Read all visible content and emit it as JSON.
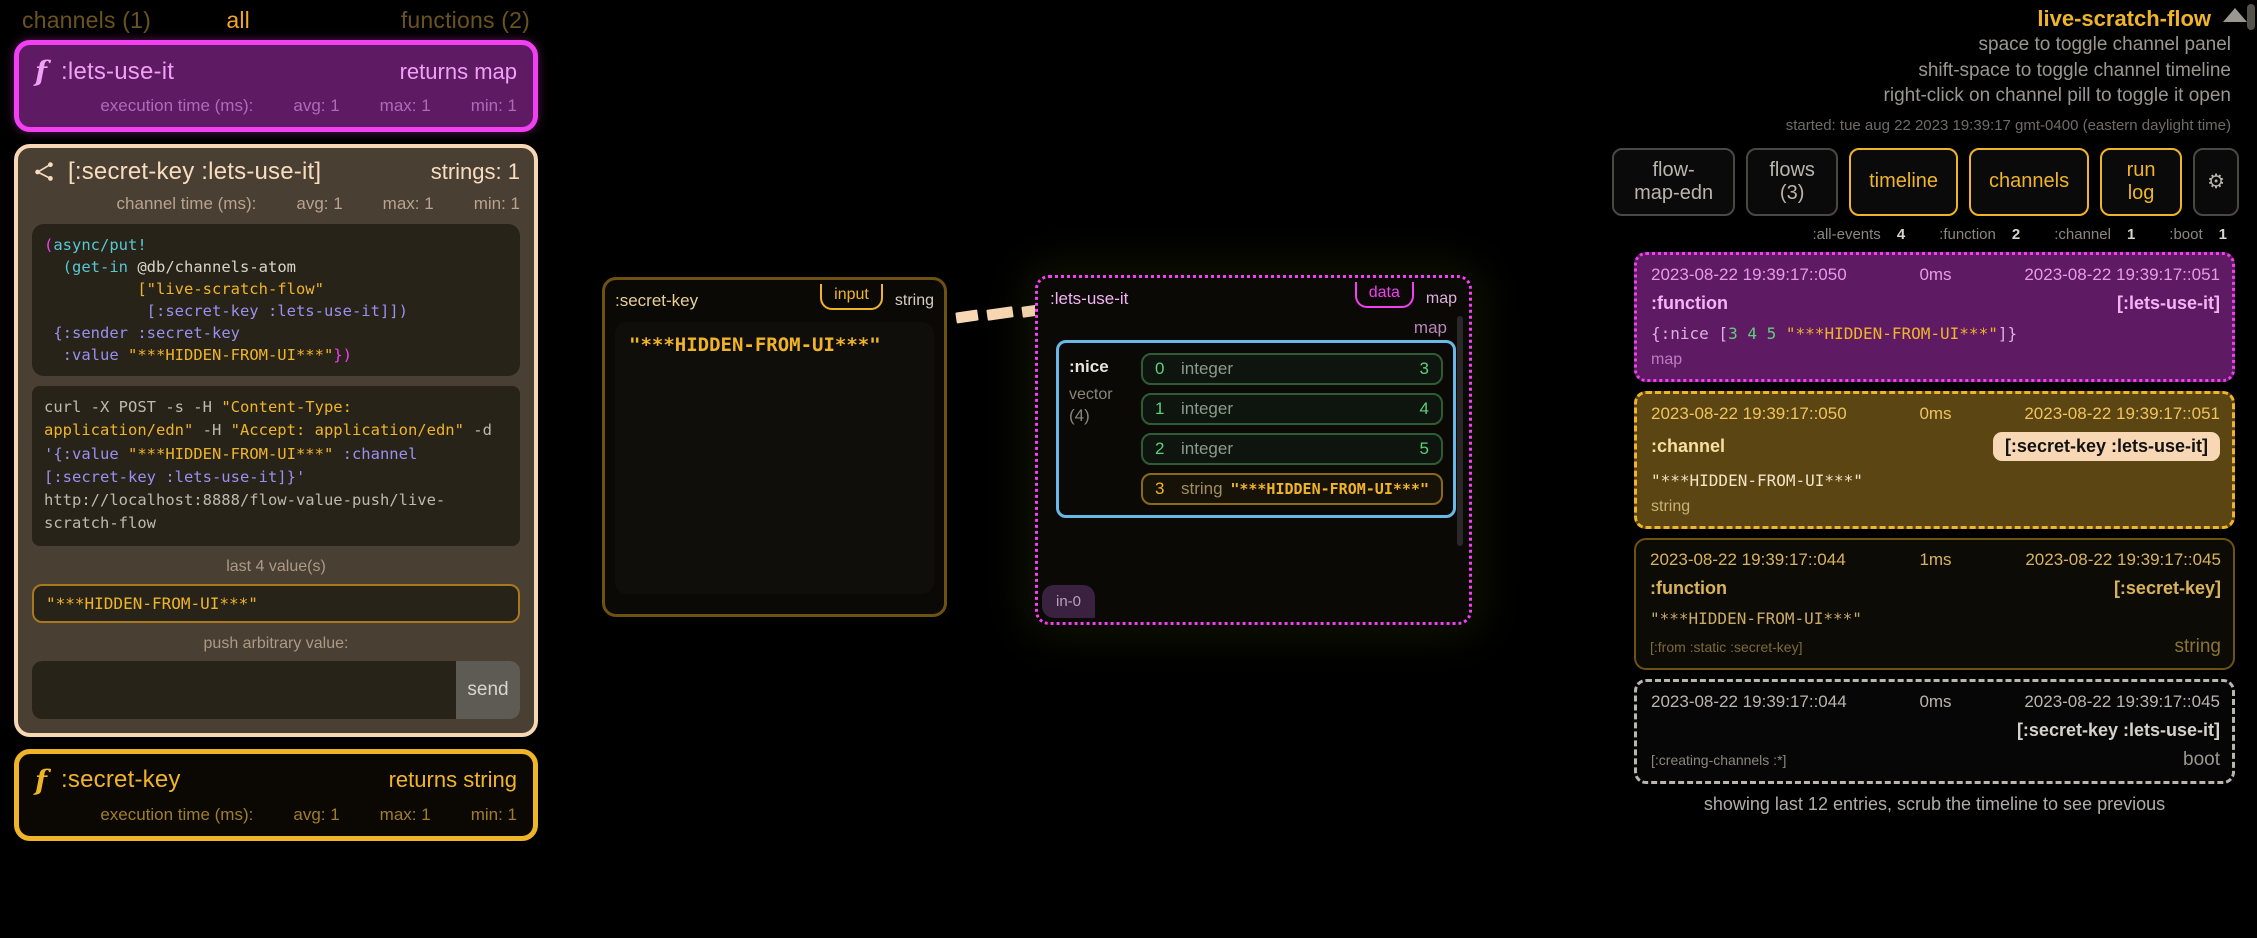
{
  "left_panel": {
    "tabs": {
      "channels": "channels (1)",
      "all": "all",
      "functions": "functions (2)"
    },
    "fn_lets_use_it": {
      "glyph": "f",
      "title": ":lets-use-it",
      "returns": "returns map",
      "stats_label": "execution time (ms):",
      "avg": "avg: 1",
      "max": "max: 1",
      "min": "min: 1"
    },
    "channel_card": {
      "icon": "share-icon",
      "title": "[:secret-key :lets-use-it]",
      "count": "strings: 1",
      "stats_label": "channel time (ms):",
      "avg": "avg: 1",
      "max": "max: 1",
      "min": "min: 1",
      "code_edn": {
        "l1_paren": "(",
        "l1_fn": "async/put!",
        "l2_paren": "(",
        "l2_fn": "get-in",
        "l2_rest": " @db/channels-atom",
        "l3_str": "[\"live-scratch-flow\"",
        "l4_kw": "[:secret-key :lets-use-it]])",
        "l5_kw": "{:sender :secret-key",
        "l6_kw": " :value ",
        "l6_str": "\"***HIDDEN-FROM-UI***\"",
        "l6_close": "})"
      },
      "code_curl": {
        "p1": "curl -X POST -s -H ",
        "p2": "\"Content-Type: application/edn\"",
        "p3": " -H ",
        "p4": "\"Accept: application/edn\"",
        "p5": " -d ",
        "p6": "'{:value ",
        "p7": "\"***HIDDEN-FROM-UI***\"",
        "p8": " :channel [:secret-key :lets-use-it]}'",
        "p9": " http://localhost:8888/flow-value-push/live-scratch-flow"
      },
      "last_values_label": "last 4 value(s)",
      "last_value": "\"***HIDDEN-FROM-UI***\"",
      "push_label": "push arbitrary value:",
      "push_input_value": "",
      "push_input_placeholder": "",
      "send_label": "send"
    },
    "fn_secret_key": {
      "glyph": "f",
      "title": ":secret-key",
      "returns": "returns string",
      "stats_label": "execution time (ms):",
      "avg": "avg: 1",
      "max": "max: 1",
      "min": "min: 1"
    }
  },
  "canvas": {
    "node_secret_key": {
      "name": ":secret-key",
      "port": "input",
      "type": "string",
      "value": "\"***HIDDEN-FROM-UI***\""
    },
    "node_lets_use_it": {
      "name": ":lets-use-it",
      "port": "data",
      "type": "map",
      "map_tag": "map",
      "in_port": "in-0",
      "vector": {
        "key": ":nice",
        "type": "vector",
        "count": "(4)",
        "items": [
          {
            "idx": "0",
            "type": "integer",
            "value": "3"
          },
          {
            "idx": "1",
            "type": "integer",
            "value": "4"
          },
          {
            "idx": "2",
            "type": "integer",
            "value": "5"
          },
          {
            "idx": "3",
            "type": "string",
            "value": "\"***HIDDEN-FROM-UI***\""
          }
        ]
      }
    }
  },
  "right_panel": {
    "flow_title": "live-scratch-flow",
    "hints": [
      "space to toggle channel panel",
      "shift-space to toggle channel timeline",
      "right-click on channel pill to toggle it open"
    ],
    "started": "started: tue aug 22 2023 19:39:17 gmt-0400 (eastern daylight time)",
    "toolbar": [
      {
        "label": "flow-map-edn",
        "active": false
      },
      {
        "label": "flows (3)",
        "active": false
      },
      {
        "label": "timeline",
        "active": true
      },
      {
        "label": "channels",
        "active": true
      },
      {
        "label": "run log",
        "active": true
      }
    ],
    "gear_icon": "gear-icon",
    "filters": [
      {
        "label": ":all-events",
        "count": "4"
      },
      {
        "label": ":function",
        "count": "2"
      },
      {
        "label": ":channel",
        "count": "1"
      },
      {
        "label": ":boot",
        "count": "1"
      }
    ],
    "logs": [
      {
        "start": "2023-08-22 19:39:17::050",
        "duration": "0ms",
        "end": "2023-08-22 19:39:17::051",
        "kind": ":function",
        "tag": "[:lets-use-it]",
        "value_prefix": "{:nice [",
        "value_nums": [
          "3",
          "4",
          "5"
        ],
        "value_str": "\"***HIDDEN-FROM-UI***\"",
        "value_suffix": "]}",
        "footer_left": "",
        "footer_right": "",
        "type_label": "map"
      },
      {
        "start": "2023-08-22 19:39:17::050",
        "duration": "0ms",
        "end": "2023-08-22 19:39:17::051",
        "kind": ":channel",
        "tag": "[:secret-key :lets-use-it]",
        "value": "\"***HIDDEN-FROM-UI***\"",
        "type_label": "string"
      },
      {
        "start": "2023-08-22 19:39:17::044",
        "duration": "1ms",
        "end": "2023-08-22 19:39:17::045",
        "kind": ":function",
        "tag": "[:secret-key]",
        "value": "\"***HIDDEN-FROM-UI***\"",
        "footer_left": "[:from :static :secret-key]",
        "footer_right": "string"
      },
      {
        "start": "2023-08-22 19:39:17::044",
        "duration": "0ms",
        "end": "2023-08-22 19:39:17::045",
        "kind": "",
        "tag": "[:secret-key :lets-use-it]",
        "footer_left": "[:creating-channels :*]",
        "footer_right": "boot"
      }
    ],
    "footer": "showing last 12 entries, scrub the timeline to see previous"
  },
  "colors": {
    "accent_amber": "#f0b429",
    "accent_magenta": "#f23ff2",
    "accent_peach": "#f8d7b4",
    "accent_blue": "#6ab8e8",
    "accent_green": "#5fd07a",
    "background": "#000000"
  }
}
